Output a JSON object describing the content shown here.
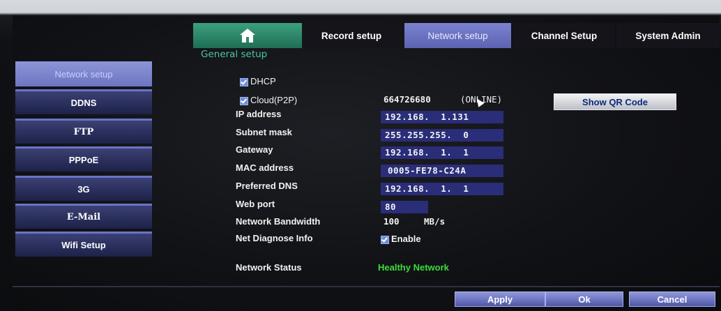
{
  "tabs": {
    "home_icon": "home-icon",
    "record": "Record setup",
    "network": "Network setup",
    "channel": "Channel Setup",
    "system": "System Admin"
  },
  "section_title": "General setup",
  "sidebar": {
    "items": [
      {
        "label": "Network setup",
        "active": true
      },
      {
        "label": "DDNS"
      },
      {
        "label": "FTP"
      },
      {
        "label": "PPPoE"
      },
      {
        "label": "3G"
      },
      {
        "label": "E-Mail"
      },
      {
        "label": "Wifi Setup"
      }
    ]
  },
  "form": {
    "dhcp_label": "DHCP",
    "dhcp_checked": true,
    "cloud_label": "Cloud(P2P)",
    "cloud_checked": true,
    "cloud_id": "664726680",
    "cloud_status": "(ONLINE)",
    "show_qr_label": "Show QR Code",
    "ip_label": "IP address",
    "ip_value": "192.168.  1.131",
    "subnet_label": "Subnet mask",
    "subnet_value": "255.255.255.  0",
    "gateway_label": "Gateway",
    "gateway_value": "192.168.  1.  1",
    "mac_label": "MAC address",
    "mac_value": "0005-FE78-C24A",
    "dns_label": "Preferred DNS",
    "dns_value": "192.168.  1.  1",
    "webport_label": "Web port",
    "webport_value": "80",
    "bandwidth_label": "Network Bandwidth",
    "bandwidth_value": "100",
    "bandwidth_unit": "MB/s",
    "diagnose_label": "Net Diagnose Info",
    "diagnose_option": "Enable",
    "diagnose_checked": true,
    "status_label": "Network Status",
    "status_value": "Healthy Network"
  },
  "colors": {
    "status_ok": "#3cdc3c",
    "section_title": "#49c7a4",
    "field_bg": "#2a2d78",
    "active_tab": "#6d75c0"
  },
  "footer": {
    "apply": "Apply",
    "ok": "Ok",
    "cancel": "Cancel"
  }
}
